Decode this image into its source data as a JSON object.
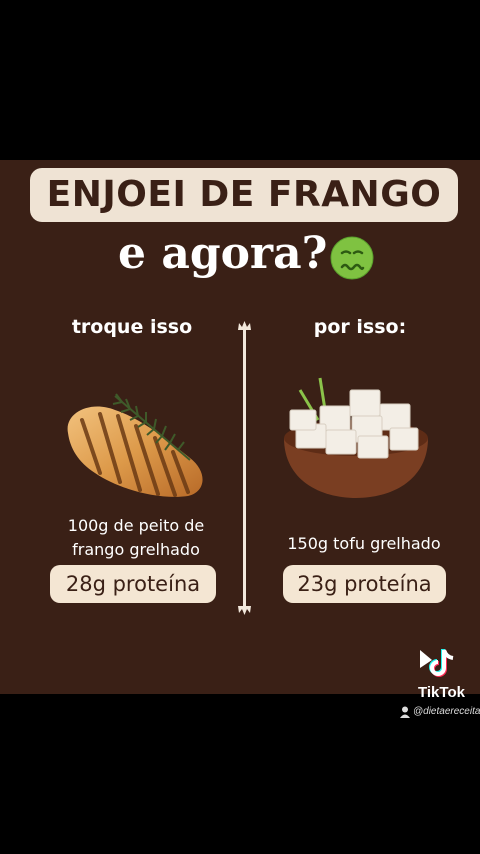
{
  "post": {
    "title": "ENJOEI DE FRANGO",
    "subtitle": "e agora?",
    "left": {
      "heading": "troque isso",
      "description_line1": "100g de peito de",
      "description_line2": "frango grelhado",
      "protein": "28g proteína"
    },
    "right": {
      "heading": "por isso:",
      "description": "150g tofu grelhado",
      "protein": "23g proteína"
    }
  },
  "watermark": {
    "brand": "TikTok",
    "handle": "@dietaereceitas"
  },
  "colors": {
    "background": "#3a2016",
    "pill": "#f4e6d3",
    "title_box": "#efe3d4"
  }
}
